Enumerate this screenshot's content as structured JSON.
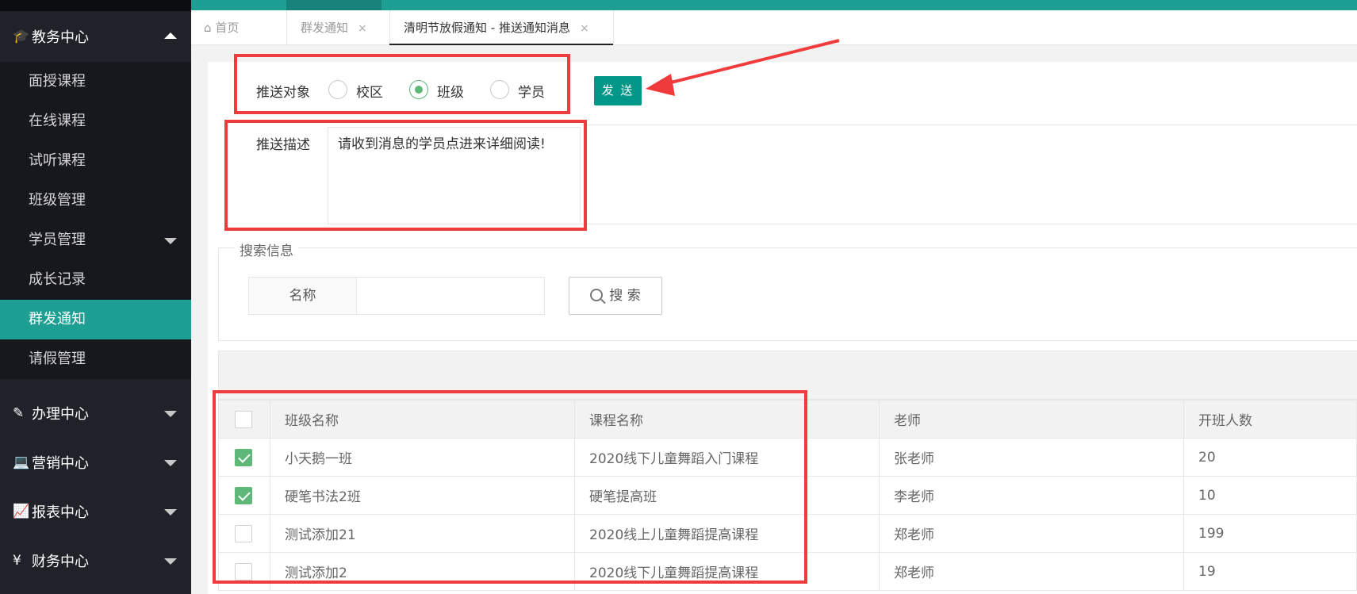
{
  "sidebar": {
    "groups": [
      {
        "label": "教务中心",
        "icon": "graduation-cap-icon"
      },
      {
        "label": "办理中心",
        "icon": "edit-icon"
      },
      {
        "label": "营销中心",
        "icon": "laptop-icon"
      },
      {
        "label": "报表中心",
        "icon": "line-chart-icon"
      },
      {
        "label": "财务中心",
        "icon": "yen-icon"
      }
    ],
    "items": [
      {
        "label": "面授课程"
      },
      {
        "label": "在线课程"
      },
      {
        "label": "试听课程"
      },
      {
        "label": "班级管理"
      },
      {
        "label": "学员管理"
      },
      {
        "label": "成长记录"
      },
      {
        "label": "群发通知"
      },
      {
        "label": "请假管理"
      }
    ],
    "active_item": "群发通知"
  },
  "tabs": [
    {
      "label": "首页",
      "icon": "home-icon"
    },
    {
      "label": "群发通知",
      "close": "×"
    },
    {
      "label": "清明节放假通知 - 推送通知消息",
      "close": "×"
    }
  ],
  "form": {
    "target_label": "推送对象",
    "options": [
      {
        "label": "校区",
        "selected": false
      },
      {
        "label": "班级",
        "selected": true
      },
      {
        "label": "学员",
        "selected": false
      }
    ],
    "send_label": "发 送",
    "desc_label": "推送描述",
    "desc_value": "请收到消息的学员点进来详细阅读!"
  },
  "search": {
    "legend": "搜索信息",
    "name_label": "名称",
    "name_value": "",
    "button_label": "搜 索"
  },
  "table": {
    "columns": [
      "班级名称",
      "课程名称",
      "老师",
      "开班人数"
    ],
    "rows": [
      {
        "checked": true,
        "cells": [
          "小天鹅一班",
          "2020线下儿童舞蹈入门课程",
          "张老师",
          "20"
        ]
      },
      {
        "checked": true,
        "cells": [
          "硬笔书法2班",
          "硬笔提高班",
          "李老师",
          "10"
        ]
      },
      {
        "checked": false,
        "cells": [
          "测试添加21",
          "2020线上儿童舞蹈提高课程",
          "郑老师",
          "199"
        ]
      },
      {
        "checked": false,
        "cells": [
          "测试添加2",
          "2020线下儿童舞蹈提高课程",
          "郑老师",
          "19"
        ]
      }
    ]
  },
  "colors": {
    "accent": "#1e9f94",
    "button": "#009688",
    "check": "#5fb878",
    "annotation": "#ef3b3b"
  }
}
